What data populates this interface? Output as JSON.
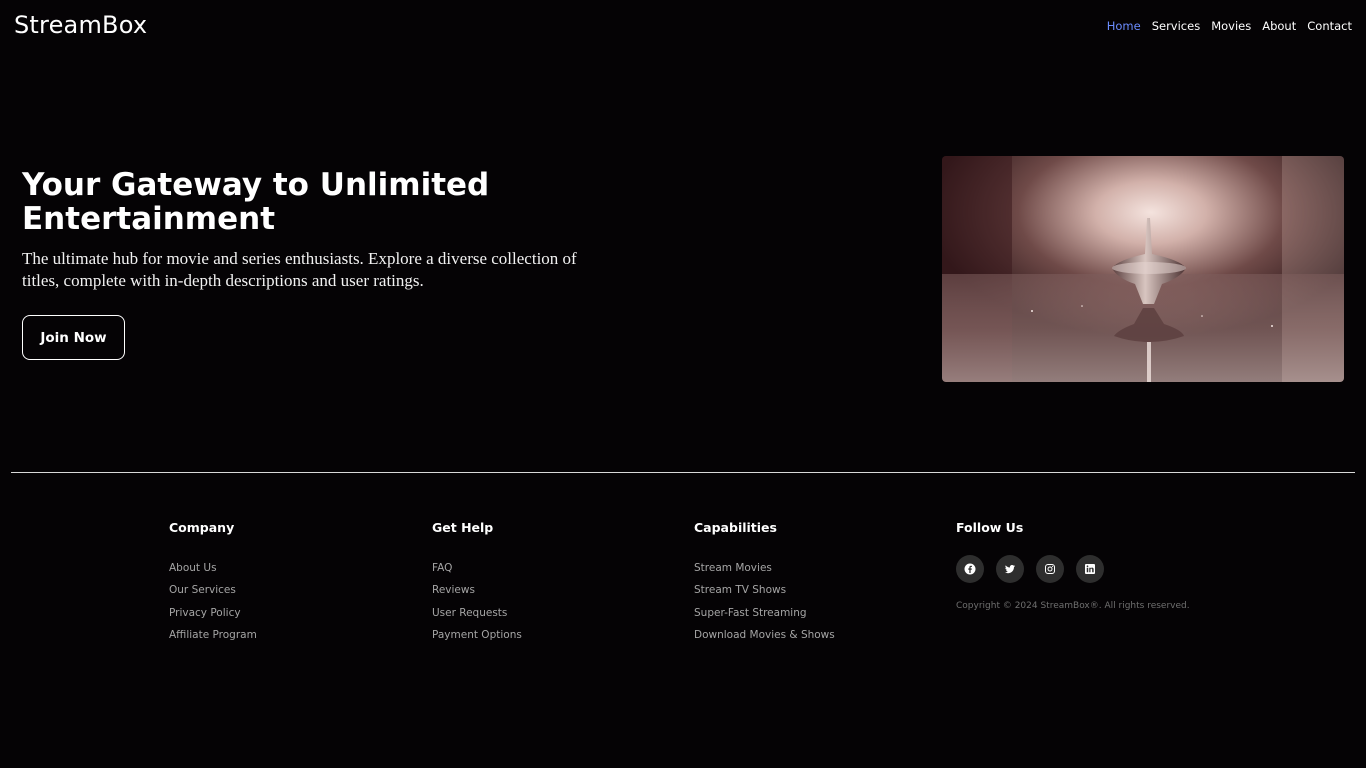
{
  "header": {
    "brand": "StreamBox",
    "nav": [
      {
        "label": "Home",
        "active": true
      },
      {
        "label": "Services",
        "active": false
      },
      {
        "label": "Movies",
        "active": false
      },
      {
        "label": "About",
        "active": false
      },
      {
        "label": "Contact",
        "active": false
      }
    ]
  },
  "hero": {
    "title": "Your Gateway to Unlimited Entertainment",
    "description": "The ultimate hub for movie and series enthusiasts. Explore a diverse collection of titles, complete with in-depth descriptions and user ratings.",
    "cta_label": "Join Now",
    "image_icon": "spinning-top-image"
  },
  "footer": {
    "company": {
      "heading": "Company",
      "links": [
        "About Us",
        "Our Services",
        "Privacy Policy",
        "Affiliate Program"
      ]
    },
    "help": {
      "heading": "Get Help",
      "links": [
        "FAQ",
        "Reviews",
        "User Requests",
        "Payment Options"
      ]
    },
    "capabilities": {
      "heading": "Capabilities",
      "links": [
        "Stream Movies",
        "Stream TV Shows",
        "Super-Fast Streaming",
        "Download Movies & Shows"
      ]
    },
    "follow": {
      "heading": "Follow Us",
      "socials": [
        "facebook-icon",
        "twitter-icon",
        "instagram-icon",
        "linkedin-icon"
      ],
      "copyright": "Copyright © 2024 StreamBox®. All rights reserved."
    }
  },
  "colors": {
    "background": "#050305",
    "accent_nav": "#6b8cff",
    "muted_link": "#a5a5a5",
    "social_bg": "#2e2e2e"
  }
}
